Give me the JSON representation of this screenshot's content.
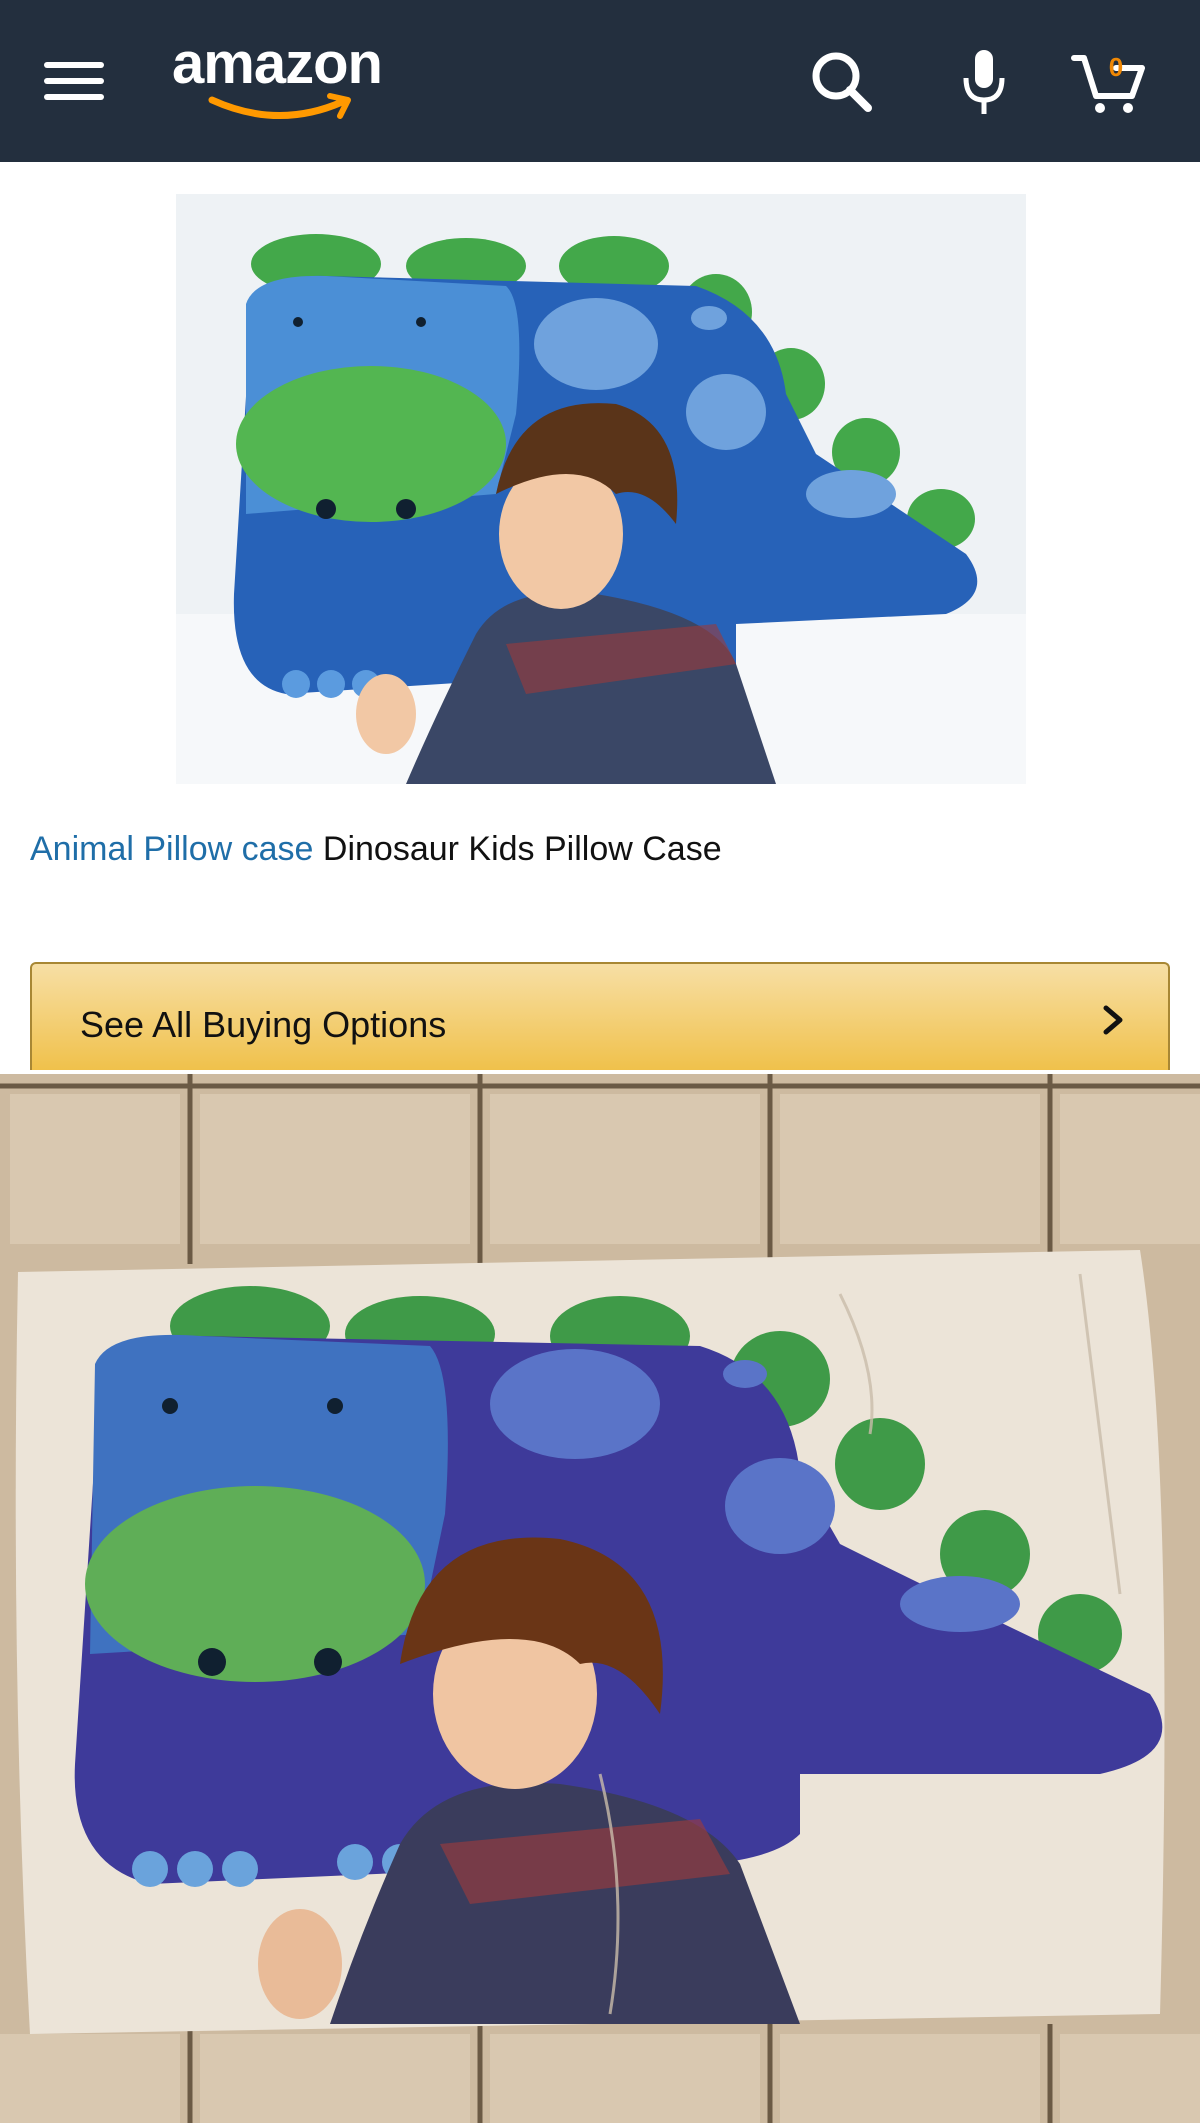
{
  "header": {
    "logo_text": "amazon",
    "cart_count": "0",
    "icons": [
      "menu-icon",
      "search-icon",
      "microphone-icon",
      "cart-icon"
    ],
    "colors": {
      "bar": "#232f3e",
      "smile": "#ff9900",
      "cart_count": "#f08804"
    }
  },
  "product": {
    "title_link": "Animal Pillow case",
    "title_rest": "Dinosaur Kids Pillow Case"
  },
  "buy_options": {
    "label": "See All Buying Options",
    "colors": {
      "gradient_top": "#f7dfa5",
      "gradient_bottom": "#f0c14b",
      "border": "#a88734"
    }
  }
}
